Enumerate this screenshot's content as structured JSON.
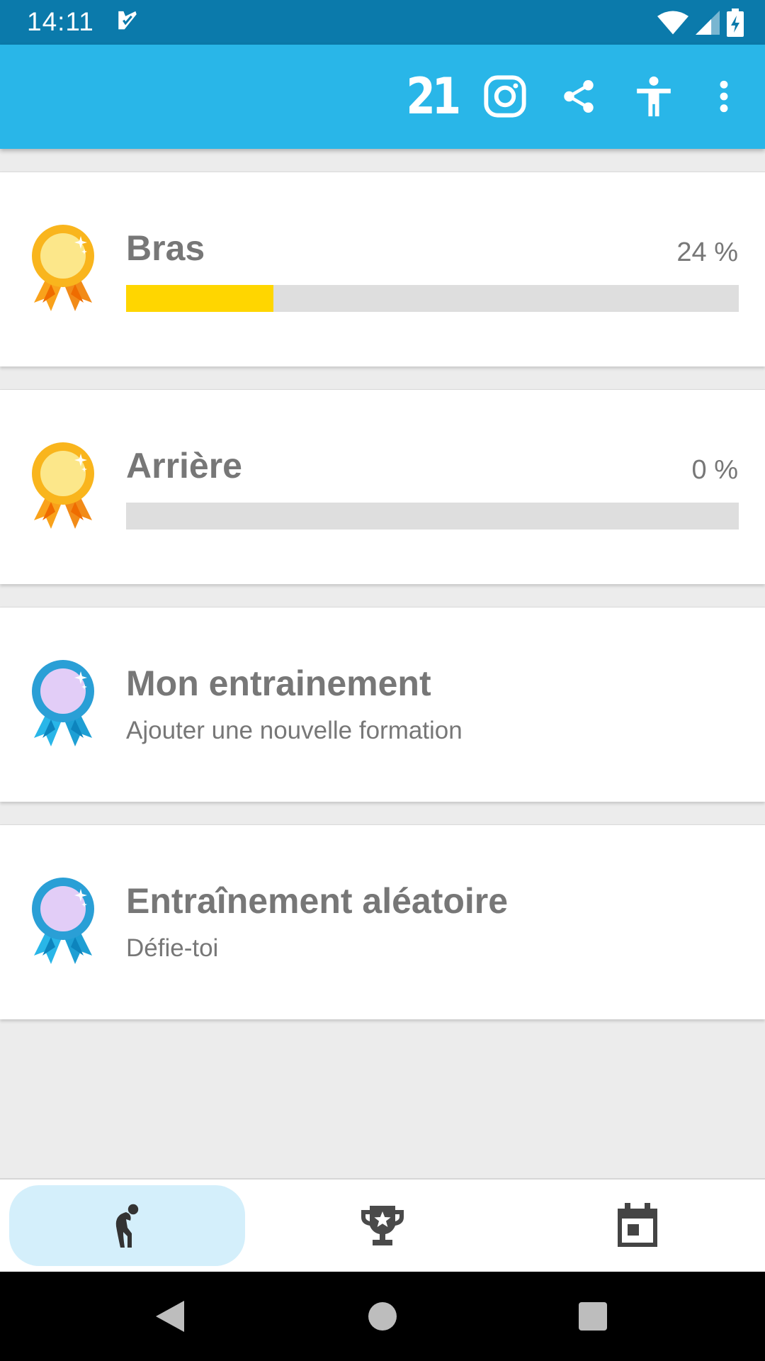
{
  "status_bar": {
    "time": "14:11",
    "icons": [
      "task-check-icon",
      "wifi-icon",
      "cellular-signal-icon",
      "battery-charging-icon"
    ]
  },
  "app_bar": {
    "badge_21_label": "21",
    "actions": [
      "instagram-icon",
      "share-icon",
      "accessibility-icon",
      "more-vert-icon"
    ],
    "color": "#29b6e8"
  },
  "cards": [
    {
      "title": "Bras",
      "progress_label": "24 %",
      "progress": 0.24,
      "medal": "gold"
    },
    {
      "title": "Arrière",
      "progress_label": "0 %",
      "progress": 0.0,
      "medal": "gold"
    },
    {
      "title": "Mon entrainement",
      "subtitle": "Ajouter une nouvelle formation",
      "medal": "blue"
    },
    {
      "title": "Entraînement aléatoire",
      "subtitle": "Défie-toi",
      "medal": "blue"
    }
  ],
  "bottom_nav": {
    "items": [
      "exercise-icon",
      "trophy-icon",
      "calendar-icon"
    ],
    "active_index": 0
  },
  "colors": {
    "progress_fill": "#ffd600",
    "progress_track": "#dedede",
    "status_bar": "#0b7aab"
  }
}
